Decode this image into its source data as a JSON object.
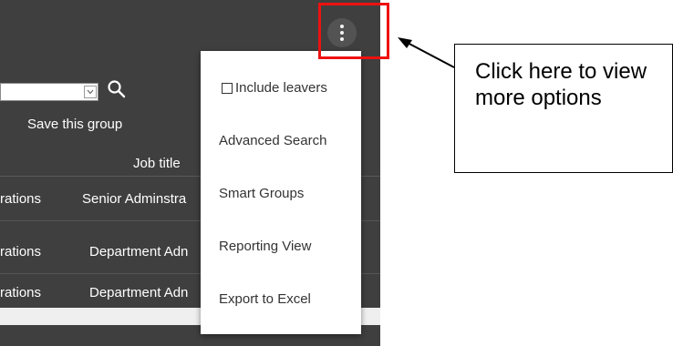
{
  "toolbar": {
    "more_options_icon": "kebab-vertical-icon",
    "search_icon": "search-icon",
    "group_select_value": "",
    "save_group_label": "Save this group"
  },
  "table": {
    "columns": [
      "Job title"
    ],
    "rows": [
      {
        "department": "rations",
        "job_title": "Senior Adminstra"
      },
      {
        "department": "rations",
        "job_title": "Department Adn"
      },
      {
        "department": "rations",
        "job_title": "Department Adn"
      }
    ]
  },
  "menu": {
    "items": [
      {
        "label": "Include leavers",
        "type": "checkbox",
        "checked": false
      },
      {
        "label": "Advanced Search"
      },
      {
        "label": "Smart Groups"
      },
      {
        "label": "Reporting View"
      },
      {
        "label": "Export to Excel"
      }
    ]
  },
  "annotation": {
    "callout_text": "Click here to view more options",
    "highlight_color": "#ee1111"
  },
  "colors": {
    "panel_bg": "#3f3f3f",
    "menu_bg": "#ffffff",
    "menu_text": "#333333"
  }
}
